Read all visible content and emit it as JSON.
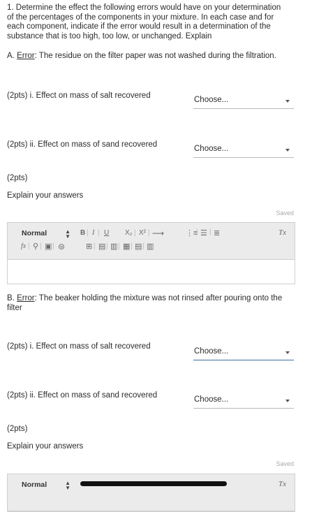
{
  "question": {
    "line1": "1. Determine the effect the following errors would have on your determination",
    "line2": "of the percentages of the components in your mixture. In each case and for",
    "line3": "each component, indicate if the error would result in a determination of the",
    "line4": "substance that is too high, too low, or unchanged. Explain"
  },
  "sectionA": {
    "prefix": "A. ",
    "err_word": "Error",
    "text": ": The residue on the filter paper was not washed during the filtration.",
    "item_i_label": "(2pts)  i. Effect on mass of salt recovered",
    "item_i_value": "Choose...",
    "item_ii_label": "(2pts)  ii. Effect on mass of sand recovered",
    "item_ii_value": "Choose...",
    "pts_label": "(2pts)",
    "explain_label": "Explain your answers",
    "saved": "Saved",
    "format_value": "Normal"
  },
  "sectionB": {
    "prefix": "B. ",
    "err_word": "Error",
    "text_line1": ": The beaker holding the mixture was not rinsed after pouring onto the",
    "text_line2": "filter",
    "item_i_label": "(2pts)  i. Effect on mass of salt recovered",
    "item_i_value": "Choose...",
    "item_ii_label": "(2pts)  ii. Effect on mass of sand recovered",
    "item_ii_value": "Choose...",
    "pts_label": "(2pts)",
    "explain_label": "Explain your answers",
    "saved": "Saved",
    "format_value": "Normal"
  },
  "toolbar": {
    "bold": "B",
    "italic": "I",
    "underline": "U",
    "subscript": "X₂",
    "superscript": "X²",
    "arrow": "⟶",
    "formula": "fx",
    "clear_format": "Tx"
  },
  "colors": {
    "accent": "#3f6ea3",
    "toolbar_bg": "#ebebeb",
    "border": "#cfcfcf"
  }
}
